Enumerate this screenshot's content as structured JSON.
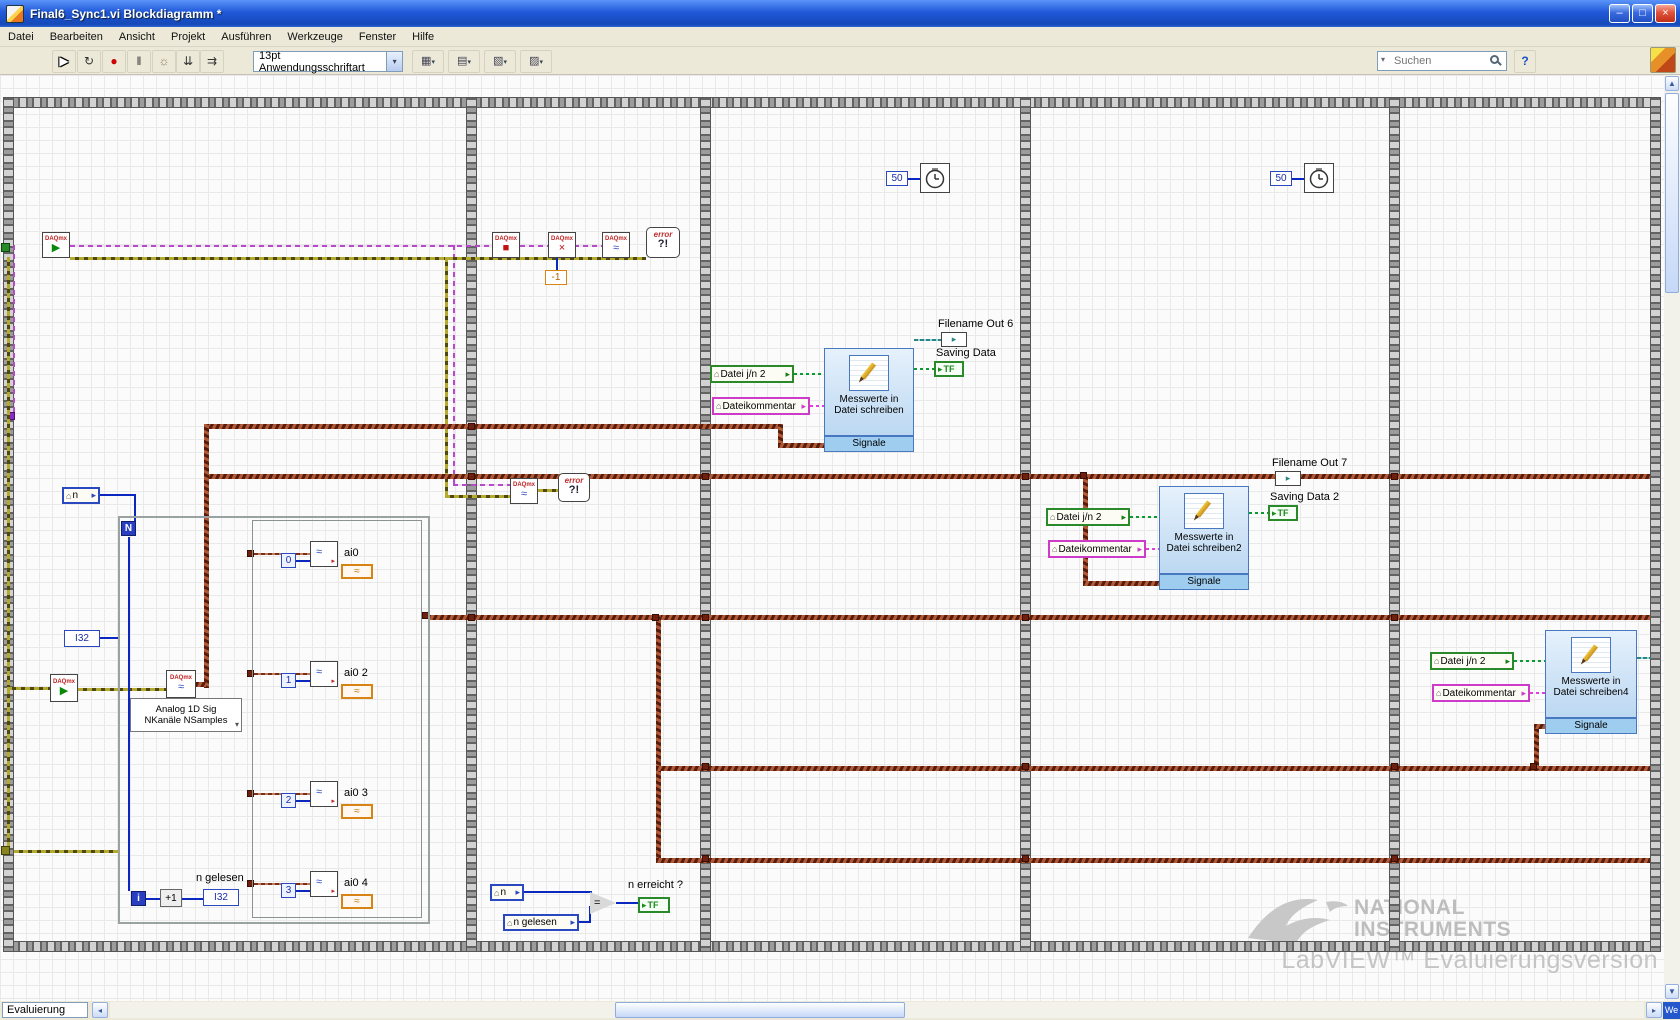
{
  "titlebar": {
    "title": "Final6_Sync1.vi Blockdiagramm *",
    "minimize_glyph": "–",
    "maximize_glyph": "□",
    "close_glyph": "×"
  },
  "menu": {
    "items": [
      "Datei",
      "Bearbeiten",
      "Ansicht",
      "Projekt",
      "Ausführen",
      "Werkzeuge",
      "Fenster",
      "Hilfe"
    ]
  },
  "toolbar": {
    "run_glyph": "▶",
    "run_cont_glyph": "↻",
    "abort_glyph": "●",
    "pause_glyph": "‖",
    "highlight_glyph": "☼",
    "step_into_glyph": "⇊",
    "step_over_glyph": "⇉",
    "font_selector": "13pt Anwendungsschriftart",
    "dropdown_glyph": "▾",
    "align_glyph": "▦",
    "distribute_glyph": "▤",
    "resize_glyph": "▧",
    "reorder_glyph": "▨",
    "search_placeholder": "Suchen",
    "help_glyph": "?"
  },
  "scrollbars": {
    "up_glyph": "▲",
    "down_glyph": "▼",
    "left_glyph": "◂",
    "right_glyph": "▸",
    "corner_text": "We"
  },
  "statusbar": {
    "target": "Evaluierung"
  },
  "watermark": {
    "brand1": "NATIONAL",
    "brand2": "INSTRUMENTS",
    "eval_line": "LabVIEW™ Evaluierungsversion"
  },
  "colors": {
    "wire_dynamic": "#6b2010",
    "wire_error": "#b4ab2e",
    "wire_task": "#b44cc8",
    "wire_bool": "#0a9a30",
    "wire_string": "#e23ce2",
    "express_vi_fill": "#cfe4f7",
    "xp_title": "#2058d8"
  },
  "glyphs": {
    "daq": "DAQmx",
    "house": "⌂",
    "arrow": "▸",
    "wave": "≈",
    "play": "▶",
    "stop": "■",
    "clear": "×",
    "error1": "error",
    "error2": "?!",
    "tf": "TF",
    "dd": "▾"
  },
  "frame1": {
    "n_label": "n",
    "loop_count": "N",
    "i32": "I32",
    "iter": "i",
    "plus1": "+1",
    "selector_line1": "Analog 1D Sig",
    "selector_line2": "NKanäle NSamples",
    "channels": [
      {
        "index": "0",
        "label": "ai0"
      },
      {
        "index": "1",
        "label": "ai0 2"
      },
      {
        "index": "2",
        "label": "ai0 3"
      },
      {
        "index": "3",
        "label": "ai0 4"
      }
    ],
    "n_read_label": "n gelesen",
    "n_read_type": "I32"
  },
  "frame2": {
    "neg1": "-1",
    "n_label": "n",
    "n_read_label": "n gelesen",
    "eq": "=",
    "n_reached": "n erreicht ?"
  },
  "frame3": {
    "wait_ms": "50",
    "file_flag": "Datei  j/n 2",
    "file_comment": "Dateikommentar",
    "vi_line1": "Messwerte in",
    "vi_line2": "Datei schreiben",
    "signals": "Signale",
    "filename_out": "Filename Out 6",
    "saving": "Saving Data"
  },
  "frame4": {
    "wait_ms": "50",
    "file_flag": "Datei  j/n 2",
    "file_comment": "Dateikommentar",
    "vi_line1": "Messwerte in",
    "vi_line2": "Datei schreiben2",
    "signals": "Signale",
    "filename_out": "Filename Out 7",
    "saving": "Saving Data 2"
  },
  "frame5": {
    "file_flag": "Datei  j/n 2",
    "file_comment": "Dateikommentar",
    "vi_line1": "Messwerte in",
    "vi_line2": "Datei schreiben4",
    "signals": "Signale"
  }
}
